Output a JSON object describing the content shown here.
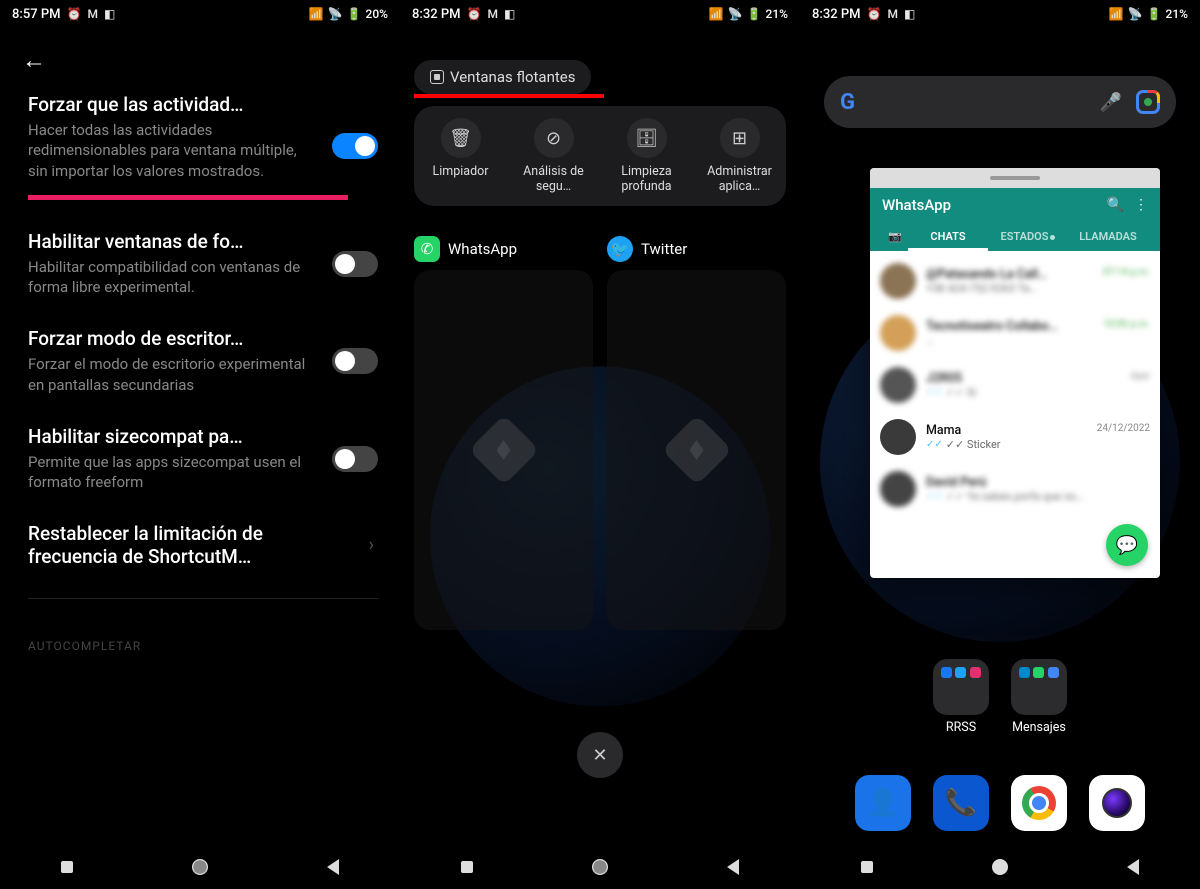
{
  "panel1": {
    "status": {
      "time": "8:57 PM",
      "battery": "20%"
    },
    "settings": [
      {
        "title": "Forzar que las actividad…",
        "desc": "Hacer todas las actividades redimensionables para ventana múltiple, sin importar los valores mostrados.",
        "toggle": true,
        "underline": true
      },
      {
        "title": "Habilitar ventanas de fo…",
        "desc": "Habilitar compatibilidad con ventanas de forma libre experimental.",
        "toggle": false
      },
      {
        "title": "Forzar modo de escritor…",
        "desc": "Forzar el modo de escritorio experimental en pantallas secundarias",
        "toggle": false
      },
      {
        "title": "Habilitar sizecompat pa…",
        "desc": "Permite que las apps sizecompat usen el formato freeform",
        "toggle": false
      }
    ],
    "chevron_item": {
      "title": "Restablecer la limitación de frecuencia de ShortcutM…"
    },
    "footer_section": "AUTOCOMPLETAR"
  },
  "panel2": {
    "status": {
      "time": "8:32 PM",
      "battery": "21%"
    },
    "chip_label": "Ventanas flotantes",
    "tools": [
      {
        "label": "Limpiador",
        "glyph": "🗑"
      },
      {
        "label": "Análisis de segu…",
        "glyph": "⊘"
      },
      {
        "label": "Limpieza profunda",
        "glyph": "🗄"
      },
      {
        "label": "Administrar aplica…",
        "glyph": "⊞"
      }
    ],
    "recents": [
      {
        "name": "WhatsApp",
        "icon_class": "wa-icon",
        "glyph": "✆"
      },
      {
        "name": "Twitter",
        "icon_class": "tw-icon",
        "glyph": "🐦"
      }
    ]
  },
  "panel3": {
    "status": {
      "time": "8:32 PM",
      "battery": "21%"
    },
    "whatsapp": {
      "title": "WhatsApp",
      "tabs": {
        "chats": "CHATS",
        "estados": "ESTADOS",
        "llamadas": "LLAMADAS"
      },
      "chats": [
        {
          "name": "@Patasando La Call…",
          "time": "07:14 p.m.",
          "msg": "+58 424-752-9263  Te…",
          "green": true
        },
        {
          "name": "Tecnotiseatro Collabo…",
          "time": "10:06 p.m.",
          "msg": "…",
          "green": true
        },
        {
          "name": "J2R05",
          "time": "Ayer",
          "msg": "✓✓ Si",
          "green": false
        },
        {
          "name": "Mama",
          "time": "24/12/2022",
          "msg": "✓✓ Sticker",
          "green": false,
          "clear": true
        },
        {
          "name": "David Perú",
          "time": "",
          "msg": "✓✓ Ya sabes porfa que no…",
          "green": false
        }
      ]
    },
    "folders": [
      {
        "label": "RRSS",
        "colors": [
          "#1877f2",
          "#1da1f2",
          "#e1306c"
        ]
      },
      {
        "label": "Mensajes",
        "colors": [
          "#0088cc",
          "#25d366",
          "#4285f4"
        ]
      }
    ]
  }
}
